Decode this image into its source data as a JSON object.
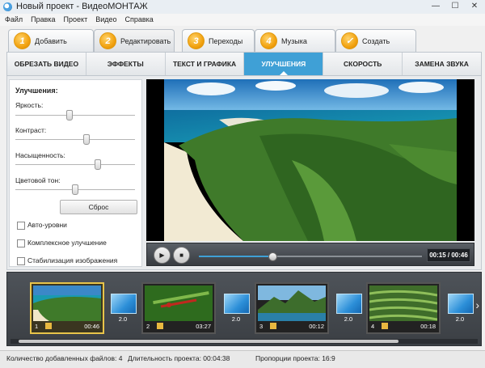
{
  "window": {
    "title": "Новый проект - ВидеоМОНТАЖ",
    "controls": [
      "—",
      "☐",
      "✕"
    ]
  },
  "menu": [
    "Файл",
    "Правка",
    "Проект",
    "Видео",
    "Справка"
  ],
  "steps": [
    {
      "num": "1",
      "label": "Добавить"
    },
    {
      "num": "2",
      "label": "Редактировать"
    },
    {
      "num": "3",
      "label": "Переходы"
    },
    {
      "num": "4",
      "label": "Музыка"
    },
    {
      "num": "✓",
      "label": "Создать"
    }
  ],
  "subtabs": [
    "ОБРЕЗАТЬ ВИДЕО",
    "ЭФФЕКТЫ",
    "ТЕКСТ И ГРАФИКА",
    "УЛУЧШЕНИЯ",
    "СКОРОСТЬ",
    "ЗАМЕНА ЗВУКА"
  ],
  "active_subtab": 3,
  "enhance": {
    "title": "Улучшения:",
    "sliders": [
      {
        "label": "Яркость:",
        "level": 0.45
      },
      {
        "label": "Контраст:",
        "level": 0.6
      },
      {
        "label": "Насыщенность:",
        "level": 0.7
      },
      {
        "label": "Цветовой тон:",
        "level": 0.5
      }
    ],
    "reset": "Сброс",
    "checkboxes": [
      "Авто-уровни",
      "Комплексное улучшение",
      "Стабилизация изображения"
    ]
  },
  "player": {
    "time": "00:15 / 00:46",
    "progress": 0.33
  },
  "clips": [
    {
      "num": "1",
      "duration": "00:46",
      "selected": true
    },
    {
      "num": "2",
      "duration": "03:27",
      "selected": false
    },
    {
      "num": "3",
      "duration": "00:12",
      "selected": false
    },
    {
      "num": "4",
      "duration": "00:18",
      "selected": false
    }
  ],
  "transitions": [
    "2.0",
    "2.0",
    "2.0",
    "2.0"
  ],
  "status": {
    "files": "Количество добавленных файлов: 4",
    "duration": "Длительность проекта: 00:04:38",
    "ratio": "Пропорции проекта: 16:9"
  },
  "colors": {
    "accent": "#3fa0d6",
    "step": "#f2a311",
    "selection": "#e8c44a"
  }
}
